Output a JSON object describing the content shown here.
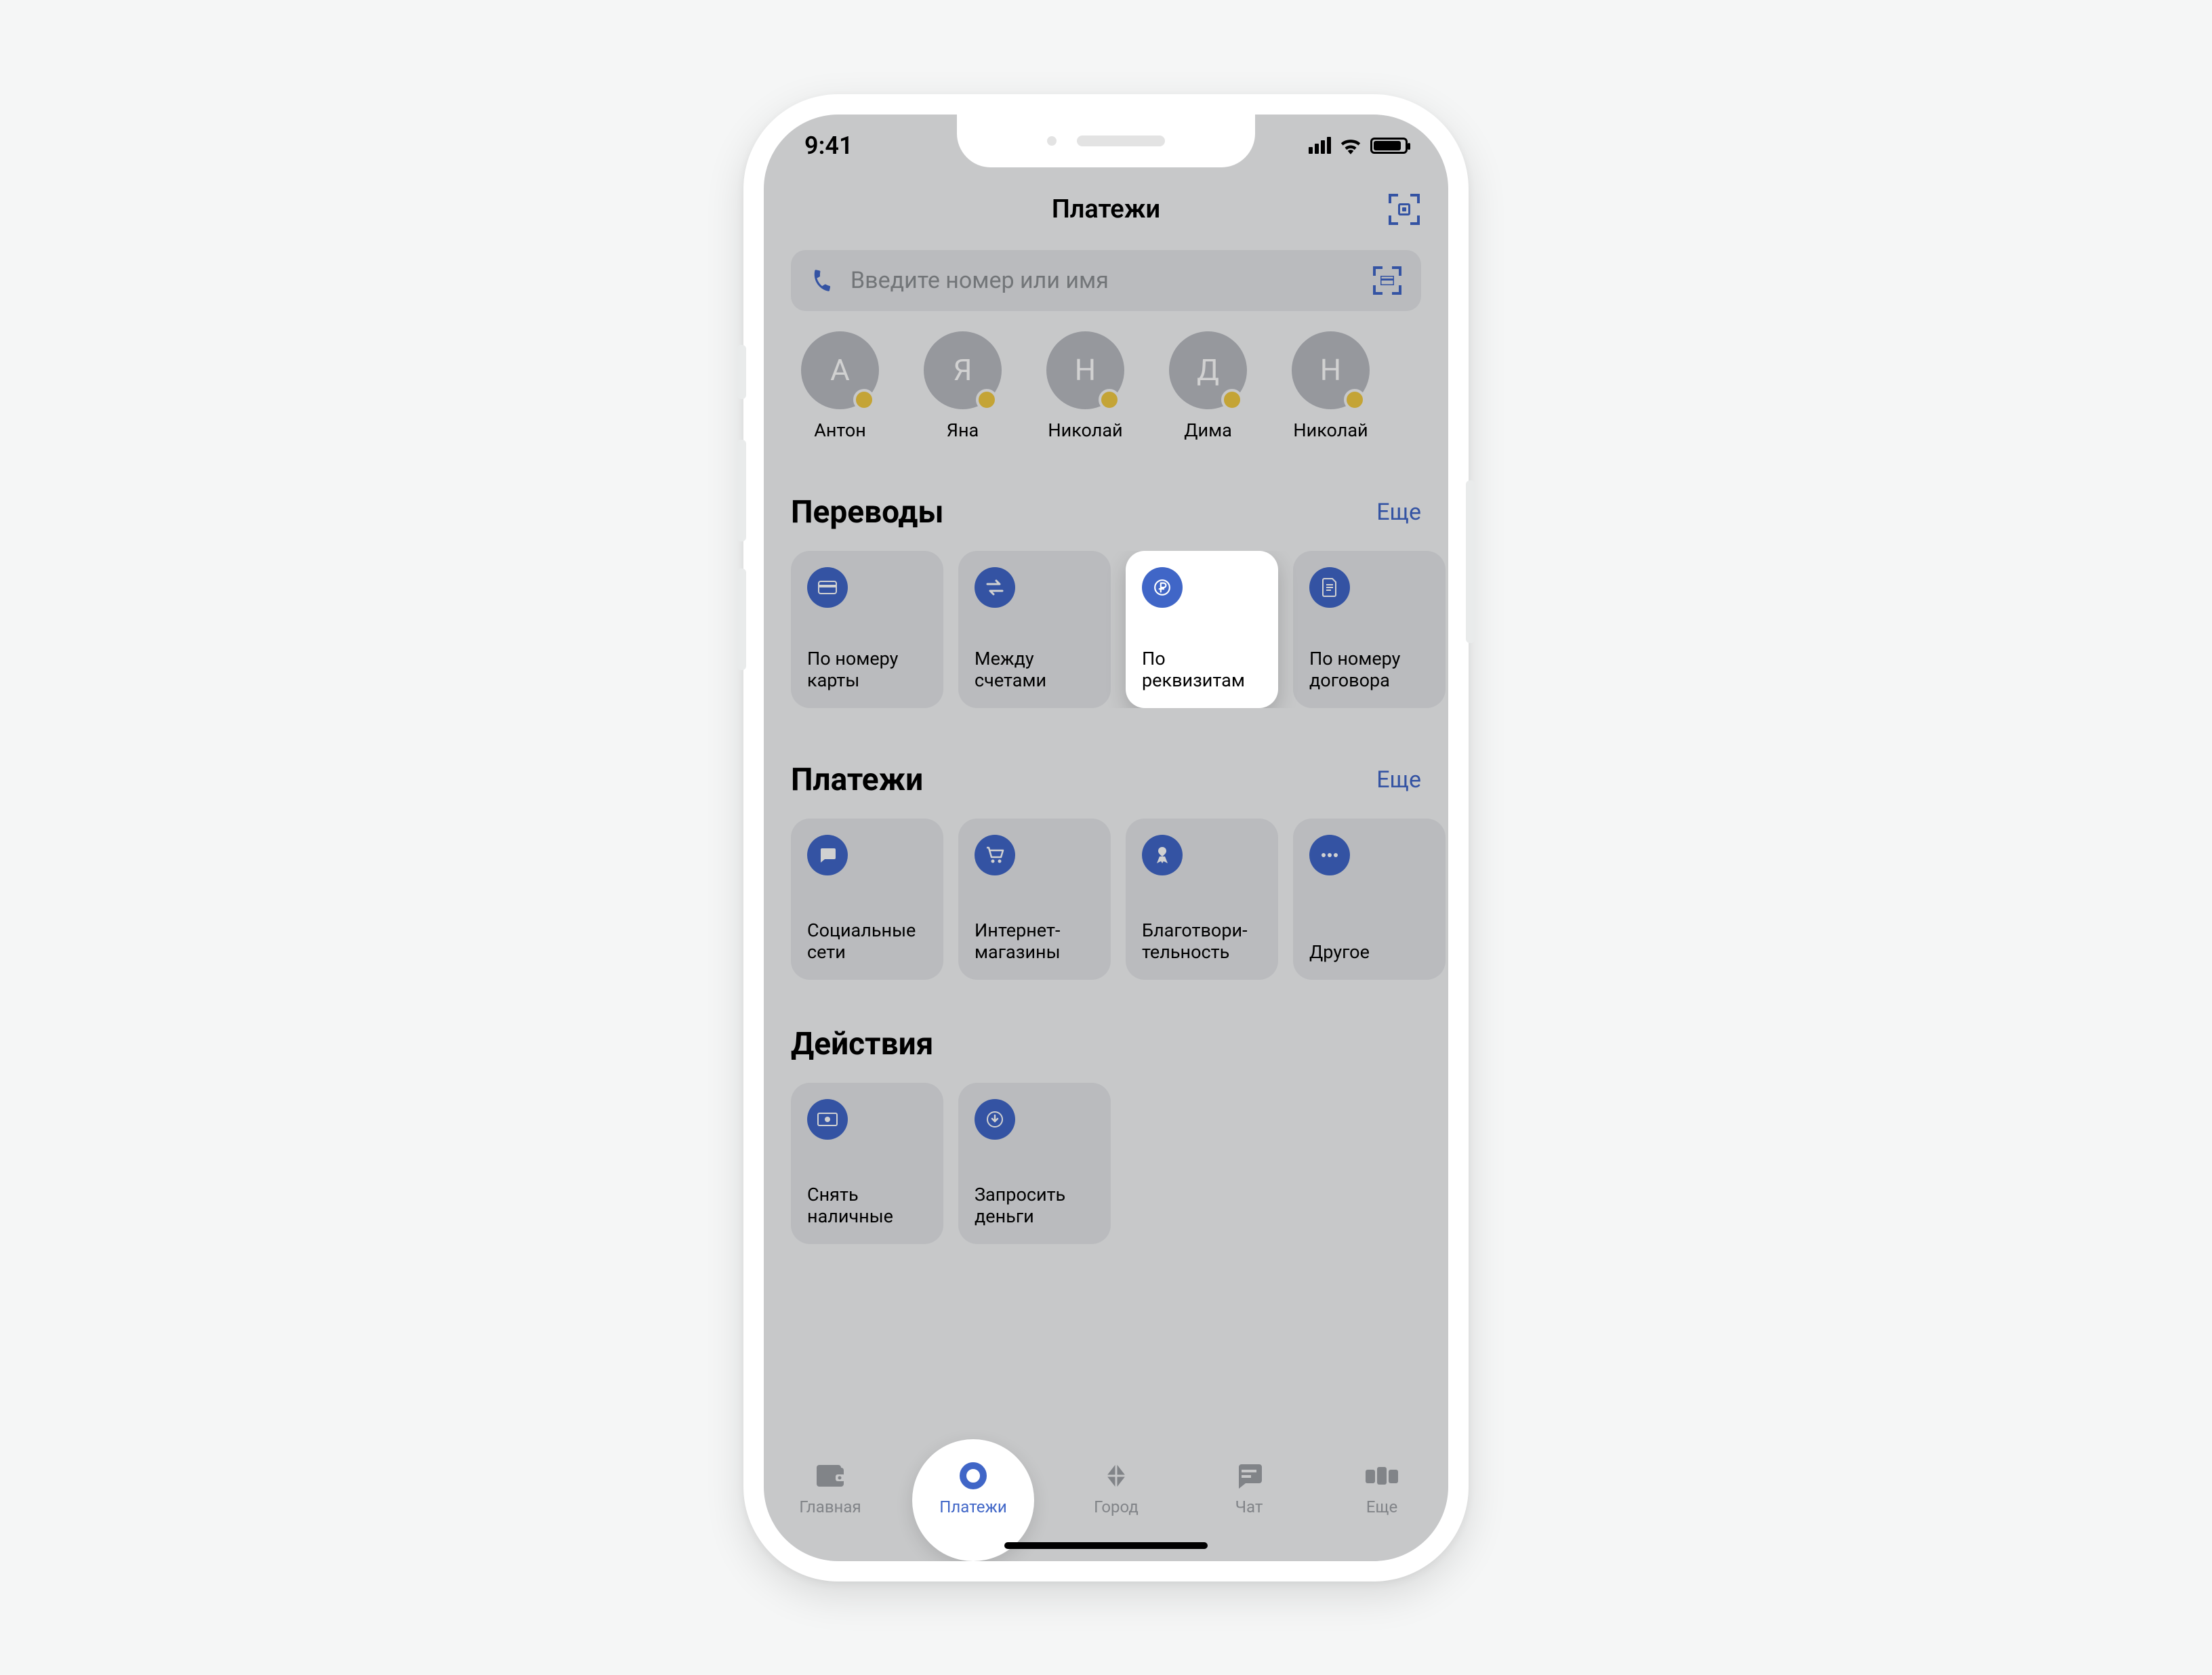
{
  "status": {
    "time": "9:41"
  },
  "header": {
    "title": "Платежи"
  },
  "search": {
    "placeholder": "Введите номер или имя"
  },
  "contacts": [
    {
      "initial": "А",
      "name": "Антон"
    },
    {
      "initial": "Я",
      "name": "Яна"
    },
    {
      "initial": "Н",
      "name": "Николай"
    },
    {
      "initial": "Д",
      "name": "Дима"
    },
    {
      "initial": "Н",
      "name": "Николай"
    }
  ],
  "sections": {
    "transfers": {
      "title": "Переводы",
      "more": "Еще",
      "cards": [
        {
          "label": "По номеру карты"
        },
        {
          "label": "Между счетами"
        },
        {
          "label": "По реквизитам",
          "highlighted": true
        },
        {
          "label": "По номеру договора"
        }
      ]
    },
    "payments": {
      "title": "Платежи",
      "more": "Еще",
      "cards": [
        {
          "label": "Социальные сети"
        },
        {
          "label": "Интернет-магазины"
        },
        {
          "label": "Благотвори-тельность"
        },
        {
          "label": "Другое"
        }
      ]
    },
    "actions": {
      "title": "Действия",
      "cards": [
        {
          "label": "Снять наличные"
        },
        {
          "label": "Запросить деньги"
        }
      ]
    }
  },
  "tabs": [
    {
      "label": "Главная"
    },
    {
      "label": "Платежи",
      "active": true
    },
    {
      "label": "Город"
    },
    {
      "label": "Чат"
    },
    {
      "label": "Еще"
    }
  ]
}
